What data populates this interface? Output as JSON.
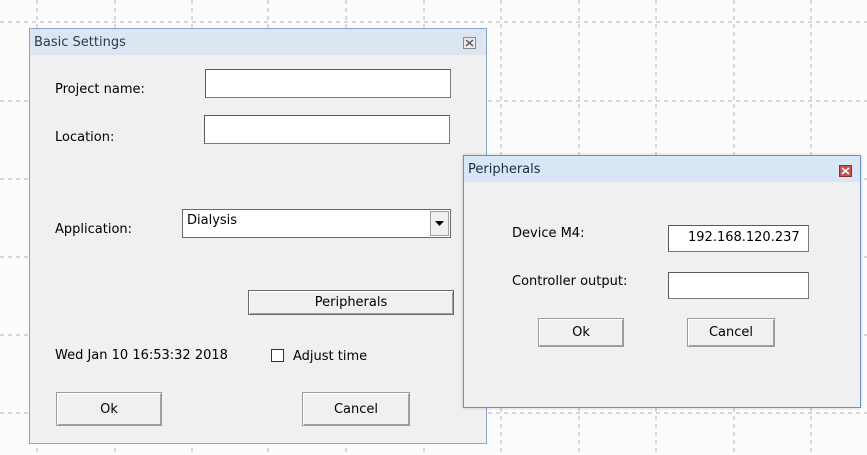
{
  "basic_settings": {
    "title": "Basic Settings",
    "project_name_label": "Project name:",
    "project_name_value": "",
    "location_label": "Location:",
    "location_value": "",
    "application_label": "Application:",
    "application_value": "Dialysis",
    "peripherals_button": "Peripherals",
    "datetime": "Wed Jan 10 16:53:32 2018",
    "adjust_time_label": "Adjust time",
    "adjust_time_checked": false,
    "ok_button": "Ok",
    "cancel_button": "Cancel"
  },
  "peripherals": {
    "title": "Peripherals",
    "device_label": "Device M4:",
    "device_value": "192.168.120.237",
    "controller_label": "Controller output:",
    "controller_value": "",
    "ok_button": "Ok",
    "cancel_button": "Cancel"
  },
  "colors": {
    "active_title_bg": "#d9e6f5",
    "inactive_title_bg": "#dbe6f1",
    "close_red": "#c75050"
  }
}
